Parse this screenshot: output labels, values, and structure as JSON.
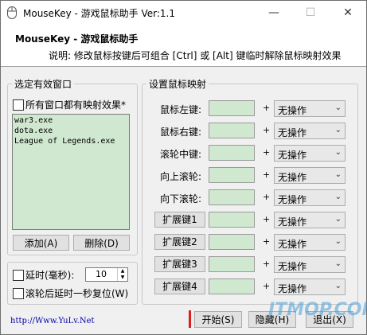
{
  "window": {
    "title": "MouseKey - 游戏鼠标助手 Ver:1.1",
    "minimize_glyph": "—",
    "maximize_glyph": "☐",
    "close_glyph": "✕"
  },
  "header": {
    "title": "MouseKey - 游戏鼠标助手",
    "description": "说明: 修改鼠标按键后可组合 [Ctrl] 或 [Alt] 键临时解除鼠标映射效果"
  },
  "left_group": {
    "title": "选定有效窗口",
    "all_windows_label": "所有窗口都有映射效果*",
    "all_windows_checked": false,
    "processes": [
      "war3.exe",
      "dota.exe",
      "League of Legends.exe"
    ],
    "add_button": "添加(A)",
    "delete_button": "删除(D)"
  },
  "delay": {
    "delay_label": "延时(毫秒):",
    "delay_checked": false,
    "delay_value": "10",
    "scroll_reset_label": "滚轮后延时一秒复位(W)",
    "scroll_reset_checked": false
  },
  "mapping": {
    "title": "设置鼠标映射",
    "plus": "+",
    "rows": [
      {
        "label": "鼠标左键:",
        "key": "",
        "action": "无操作"
      },
      {
        "label": "鼠标右键:",
        "key": "",
        "action": "无操作"
      },
      {
        "label": "滚轮中键:",
        "key": "",
        "action": "无操作"
      },
      {
        "label": "向上滚轮:",
        "key": "",
        "action": "无操作"
      },
      {
        "label": "向下滚轮:",
        "key": "",
        "action": "无操作"
      },
      {
        "label": "扩展键1",
        "key": "",
        "action": "无操作"
      },
      {
        "label": "扩展键2",
        "key": "",
        "action": "无操作"
      },
      {
        "label": "扩展键3",
        "key": "",
        "action": "无操作"
      },
      {
        "label": "扩展键4",
        "key": "",
        "action": "无操作"
      }
    ]
  },
  "footer": {
    "url": "http://Www.YuLv.Net",
    "start_button": "开始(S)",
    "hide_button": "隐藏(H)",
    "exit_button": "退出(X)",
    "watermark": "ITMOP.COM"
  },
  "colors": {
    "key_field_bg": "#cfe8cf",
    "url_color": "#0000aa",
    "start_indicator": "#d92020"
  }
}
